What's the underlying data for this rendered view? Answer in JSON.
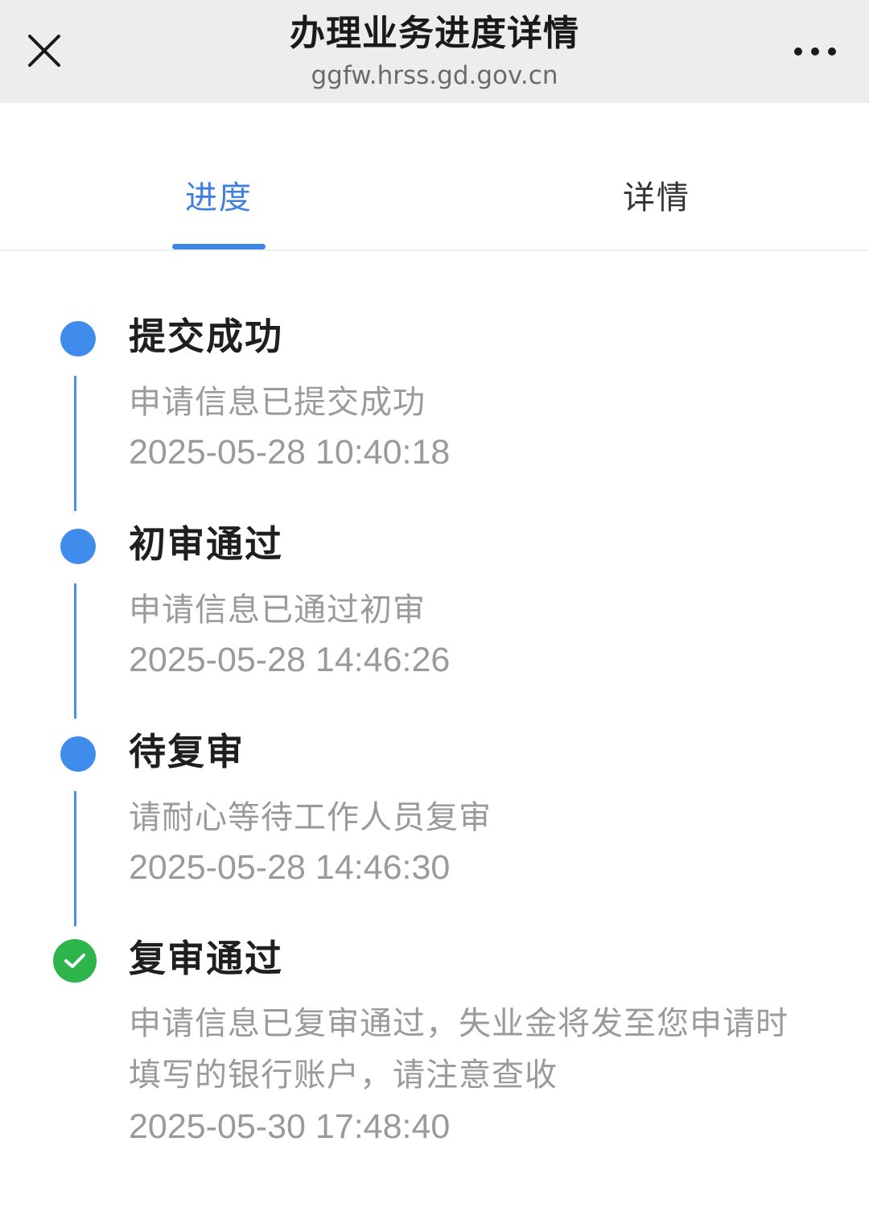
{
  "header": {
    "title": "办理业务进度详情",
    "url": "ggfw.hrss.gd.gov.cn",
    "close_icon": "close-icon",
    "more_icon": "more-icon"
  },
  "tabs": [
    {
      "label": "进度",
      "active": true
    },
    {
      "label": "详情",
      "active": false
    }
  ],
  "colors": {
    "accent": "#3f86e6",
    "success": "#2db54b"
  },
  "steps": [
    {
      "title": "提交成功",
      "desc": "申请信息已提交成功",
      "time": "2025-05-28 10:40:18",
      "status": "done"
    },
    {
      "title": "初审通过",
      "desc": "申请信息已通过初审",
      "time": "2025-05-28 14:46:26",
      "status": "done"
    },
    {
      "title": "待复审",
      "desc": "请耐心等待工作人员复审",
      "time": "2025-05-28 14:46:30",
      "status": "done"
    },
    {
      "title": "复审通过",
      "desc": "申请信息已复审通过，失业金将发至您申请时填写的银行账户，请注意查收",
      "time": "2025-05-30 17:48:40",
      "status": "complete"
    }
  ]
}
